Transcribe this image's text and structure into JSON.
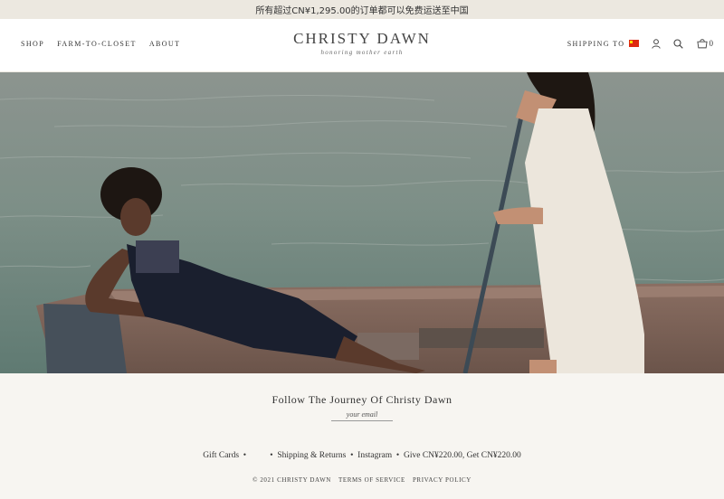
{
  "announcement": "所有超过CN¥1,295.00的订单都可以免费运送至中国",
  "nav": {
    "left": [
      "SHOP",
      "FARM-TO-CLOSET",
      "ABOUT"
    ],
    "shipping_label": "SHIPPING TO",
    "cart_count": "0"
  },
  "logo": {
    "name": "CHRISTY DAWN",
    "tagline": "honoring mother earth"
  },
  "footer": {
    "follow_title": "Follow The Journey Of Christy Dawn",
    "email_placeholder": "your email",
    "links": [
      "Gift Cards",
      "Shipping & Returns",
      "Instagram",
      "Give CN¥220.00, Get CN¥220.00"
    ],
    "legal": [
      "© 2021 CHRISTY DAWN",
      "TERMS OF SERVICE",
      "PRIVACY POLICY"
    ]
  },
  "icons": {
    "flag": "china-flag-icon",
    "account": "user-icon",
    "search": "search-icon",
    "cart": "bag-icon"
  },
  "colors": {
    "announcement_bg": "#ece8e0",
    "footer_bg": "#f7f5f1",
    "text": "#333333"
  }
}
